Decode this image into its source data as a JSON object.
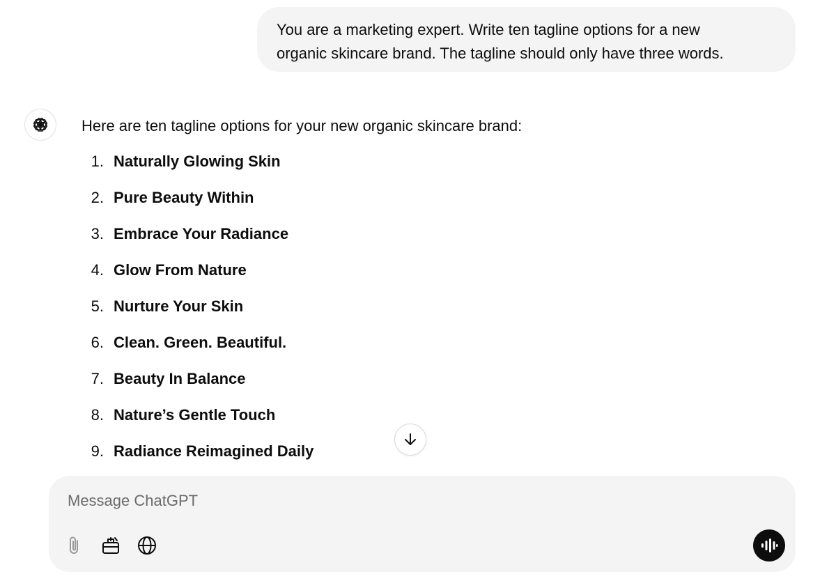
{
  "user_message": {
    "line1": "You are a marketing expert. Write ten tagline options for a new",
    "line2": "organic skincare brand. The tagline should only have three words."
  },
  "assistant": {
    "avatar_icon": "openai-logo-icon",
    "intro": "Here are ten tagline options for your new organic skincare brand:",
    "taglines": [
      {
        "num": "1.",
        "text": "Naturally Glowing Skin"
      },
      {
        "num": "2.",
        "text": "Pure Beauty Within"
      },
      {
        "num": "3.",
        "text": "Embrace Your Radiance"
      },
      {
        "num": "4.",
        "text": "Glow From Nature"
      },
      {
        "num": "5.",
        "text": "Nurture Your Skin"
      },
      {
        "num": "6.",
        "text": "Clean. Green. Beautiful."
      },
      {
        "num": "7.",
        "text": "Beauty In Balance"
      },
      {
        "num": "8.",
        "text": "Nature’s Gentle Touch"
      },
      {
        "num": "9.",
        "text": "Radiance Reimagined Daily"
      }
    ]
  },
  "scroll_button": {
    "icon": "arrow-down-icon"
  },
  "composer": {
    "placeholder": "Message ChatGPT",
    "value": "",
    "tools": [
      {
        "name": "attach-button",
        "icon": "paperclip-icon"
      },
      {
        "name": "tools-button",
        "icon": "toolbox-icon"
      },
      {
        "name": "search-web-button",
        "icon": "globe-icon"
      }
    ],
    "voice_icon": "voice-waveform-icon"
  },
  "colors": {
    "user_bubble_bg": "#f4f4f4",
    "composer_bg": "#f4f4f4",
    "text": "#0d0d0d",
    "voice_button_bg": "#0d0d0d"
  }
}
